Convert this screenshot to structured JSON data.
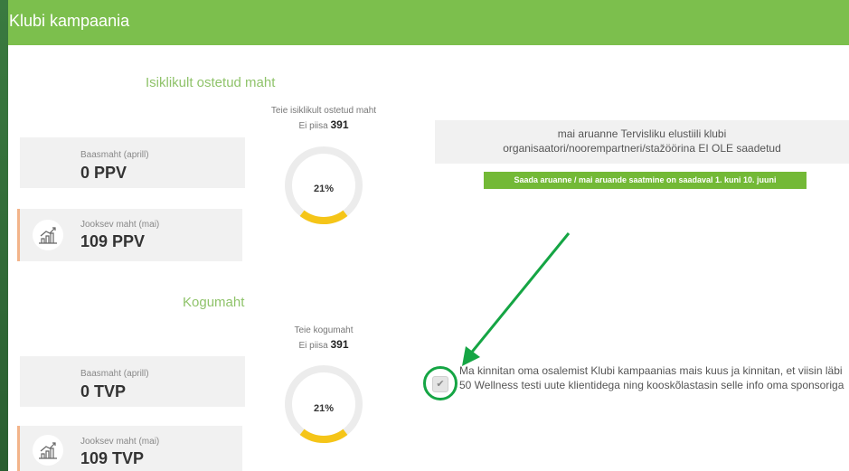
{
  "header": {
    "title": "Klubi kampaania"
  },
  "personal": {
    "section_title": "Isiklikult ostetud maht",
    "base": {
      "label": "Baasmaht (aprill)",
      "value": "0 PPV"
    },
    "current": {
      "label": "Jooksev maht (mai)",
      "value": "109 PPV"
    },
    "gauge": {
      "caption": "Teie isiklikult ostetud maht",
      "status_prefix": "Ei piisa",
      "status_value": "391",
      "percent": "21%",
      "fill": 0.21
    }
  },
  "total": {
    "section_title": "Kogumaht",
    "base": {
      "label": "Baasmaht (aprill)",
      "value": "0 TVP"
    },
    "current": {
      "label": "Jooksev maht (mai)",
      "value": "109 TVP"
    },
    "gauge": {
      "caption": "Teie kogumaht",
      "status_prefix": "Ei piisa",
      "status_value": "391",
      "percent": "21%",
      "fill": 0.21
    }
  },
  "report": {
    "line1": "mai aruanne Tervisliku elustiili klubi",
    "line2": "organisaatori/noorempartneri/stažöörina EI OLE saadetud",
    "button_label": "Saada aruanne / mai aruande saatmine on saadaval 1. kuni 10. juuni"
  },
  "confirmation": {
    "text": "Ma kinnitan oma osalemist Klubi kampaanias mais kuus ja kinnitan, et viisin läbi 50 Wellness testi uute klientidega ning kooskõlastasin selle info oma sponsoriga",
    "checkbox_glyph": "✔"
  },
  "colors": {
    "header": "#7cbf4d",
    "accent_green": "#8fc36a",
    "button_green": "#73b936",
    "gauge_fill": "#f5c518",
    "annotation": "#15a544"
  },
  "icons": [
    "growth-chart-icon",
    "check-icon",
    "arrow-annotation-icon"
  ]
}
